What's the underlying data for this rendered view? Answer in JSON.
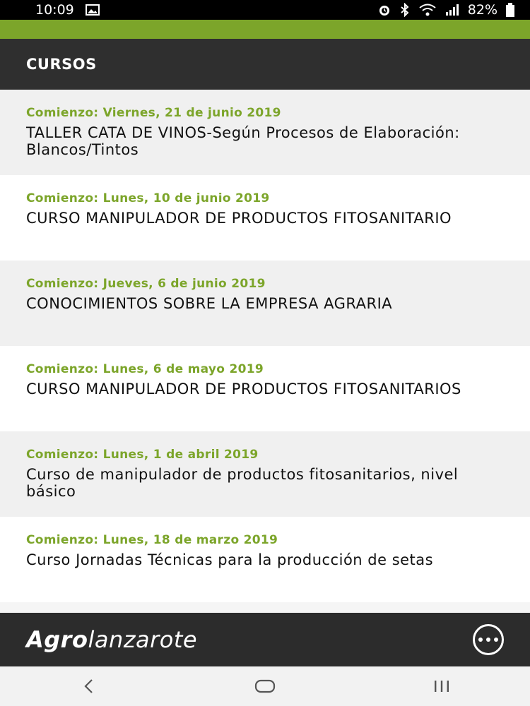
{
  "status_bar": {
    "time": "10:09",
    "battery": "82%",
    "icons": [
      "image-icon",
      "alarm-icon",
      "bluetooth-icon",
      "wifi-icon",
      "signal-icon",
      "battery-icon"
    ]
  },
  "header": {
    "title": "CURSOS"
  },
  "courses": [
    {
      "date": "Comienzo: Viernes, 21 de junio 2019",
      "title": "TALLER CATA DE VINOS-Según Procesos de Elaboración: Blancos/Tintos"
    },
    {
      "date": "Comienzo: Lunes, 10 de junio 2019",
      "title": "CURSO MANIPULADOR DE PRODUCTOS FITOSANITARIO"
    },
    {
      "date": "Comienzo: Jueves, 6 de junio 2019",
      "title": "CONOCIMIENTOS SOBRE LA EMPRESA AGRARIA"
    },
    {
      "date": "Comienzo: Lunes, 6 de mayo 2019",
      "title": "CURSO MANIPULADOR DE PRODUCTOS FITOSANITARIOS"
    },
    {
      "date": "Comienzo: Lunes, 1 de abril 2019",
      "title": "Curso de manipulador de productos fitosanitarios, nivel básico"
    },
    {
      "date": "Comienzo: Lunes, 18 de marzo 2019",
      "title": "Curso Jornadas Técnicas para la producción de setas"
    }
  ],
  "footer": {
    "logo_bold": "Agro",
    "logo_light": "lanzarote",
    "more_icon": "more-icon"
  },
  "nav": {
    "icons": [
      "back-icon",
      "home-icon",
      "recents-icon"
    ]
  },
  "colors": {
    "accent": "#7ca52a",
    "header_bg": "#2f2f2f",
    "footer_bg": "#2c2c2c"
  }
}
